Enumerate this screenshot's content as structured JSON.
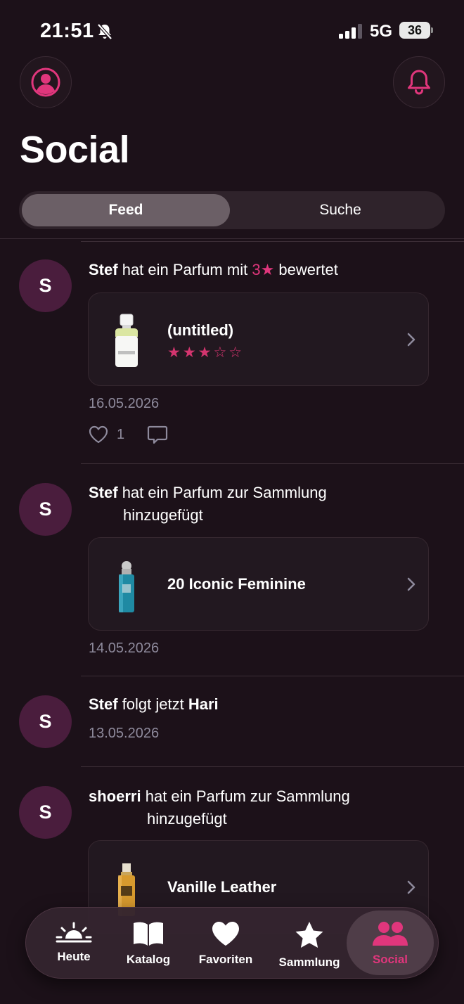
{
  "status_bar": {
    "time": "21:51",
    "network": "5G",
    "battery": "36"
  },
  "header": {
    "title": "Social"
  },
  "segments": {
    "feed": "Feed",
    "search": "Suche"
  },
  "feed": [
    {
      "avatar": "S",
      "user": "Stef",
      "action": "hat ein Parfum mit",
      "rating_text": "3★",
      "action_suffix": "bewertet",
      "card_title": "(untitled)",
      "stars_filled": "★★★",
      "stars_empty": "☆☆",
      "rating": 3,
      "date": "16.05.2026",
      "likes": "1"
    },
    {
      "avatar": "S",
      "user": "Stef",
      "action": "hat ein Parfum zur Sammlung",
      "action_cont": "hinzugefügt",
      "card_title": "20 Iconic Feminine",
      "date": "14.05.2026"
    },
    {
      "avatar": "S",
      "user": "Stef",
      "action": "folgt jetzt",
      "target": "Hari",
      "date": "13.05.2026"
    },
    {
      "avatar": "S",
      "user": "shoerri",
      "action": "hat ein Parfum zur Sammlung",
      "action_cont": "hinzugefügt",
      "card_title": "Vanille Leather"
    }
  ],
  "tabbar": {
    "items": [
      {
        "label": "Heute",
        "icon": "sunrise-icon"
      },
      {
        "label": "Katalog",
        "icon": "book-icon"
      },
      {
        "label": "Favoriten",
        "icon": "heart-icon"
      },
      {
        "label": "Sammlung",
        "icon": "star-icon"
      },
      {
        "label": "Social",
        "icon": "people-icon"
      }
    ],
    "active": "Social"
  },
  "colors": {
    "accent": "#e0367c",
    "background": "#1c1119",
    "avatar": "#4a1d3d",
    "muted": "#8e8a9c"
  }
}
